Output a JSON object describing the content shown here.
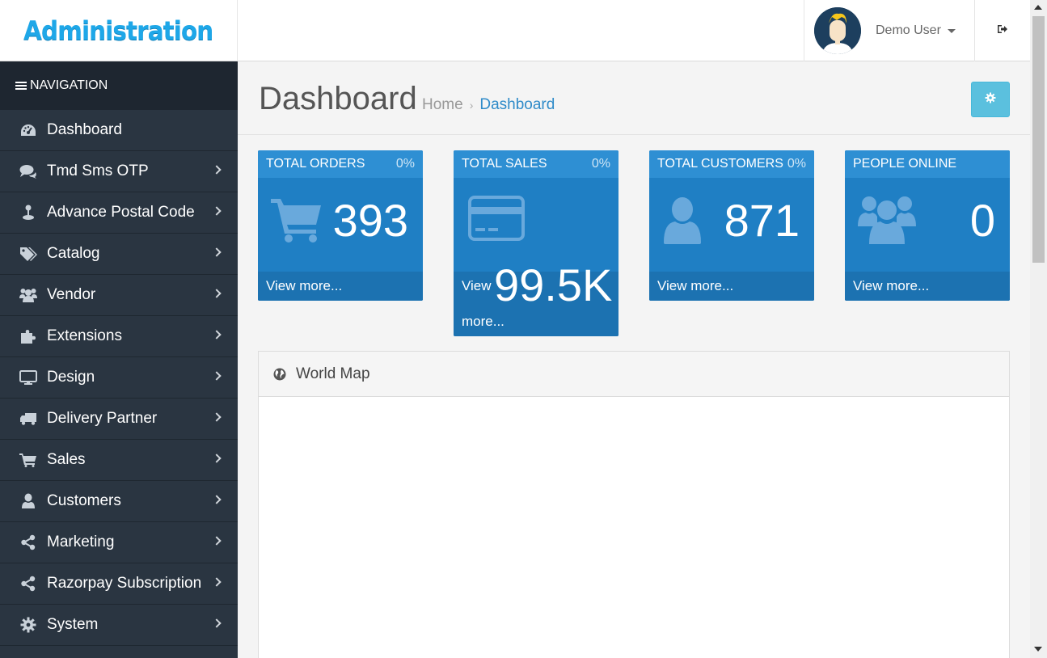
{
  "brand": "Administration",
  "user": {
    "name": "Demo User"
  },
  "nav": {
    "header": "NAVIGATION",
    "items": [
      {
        "label": "Dashboard",
        "icon": "dashboard-icon",
        "has_children": false
      },
      {
        "label": "Tmd Sms OTP",
        "icon": "comments-icon",
        "has_children": true
      },
      {
        "label": "Advance Postal Code",
        "icon": "map-pin-icon",
        "has_children": true
      },
      {
        "label": "Catalog",
        "icon": "tags-icon",
        "has_children": true
      },
      {
        "label": "Vendor",
        "icon": "users-icon",
        "has_children": true
      },
      {
        "label": "Extensions",
        "icon": "puzzle-icon",
        "has_children": true
      },
      {
        "label": "Design",
        "icon": "desktop-icon",
        "has_children": true
      },
      {
        "label": "Delivery Partner",
        "icon": "truck-icon",
        "has_children": true
      },
      {
        "label": "Sales",
        "icon": "cart-icon",
        "has_children": true
      },
      {
        "label": "Customers",
        "icon": "user-icon",
        "has_children": true
      },
      {
        "label": "Marketing",
        "icon": "share-icon",
        "has_children": true
      },
      {
        "label": "Razorpay Subscription",
        "icon": "share-icon",
        "has_children": true
      },
      {
        "label": "System",
        "icon": "cog-icon",
        "has_children": true
      }
    ]
  },
  "page": {
    "title": "Dashboard",
    "breadcrumb": [
      "Home",
      "Dashboard"
    ]
  },
  "tiles": [
    {
      "title": "TOTAL ORDERS",
      "percent": "0%",
      "value": "393",
      "footer": "View more..."
    },
    {
      "title": "TOTAL SALES",
      "percent": "0%",
      "value": "99.5K",
      "footer_prefix": "View",
      "footer_suffix": "more..."
    },
    {
      "title": "TOTAL CUSTOMERS",
      "percent": "0%",
      "value": "871",
      "footer": "View more..."
    },
    {
      "title": "PEOPLE ONLINE",
      "percent": "",
      "value": "0",
      "footer": "View more..."
    }
  ],
  "panels": {
    "world_map": {
      "title": "World Map"
    }
  },
  "colors": {
    "tile": "#1f7fc4",
    "tile_head": "#2e8fd3",
    "sidebar": "#2a3541",
    "brand": "#1ea7e8",
    "settings": "#5bc0de"
  }
}
